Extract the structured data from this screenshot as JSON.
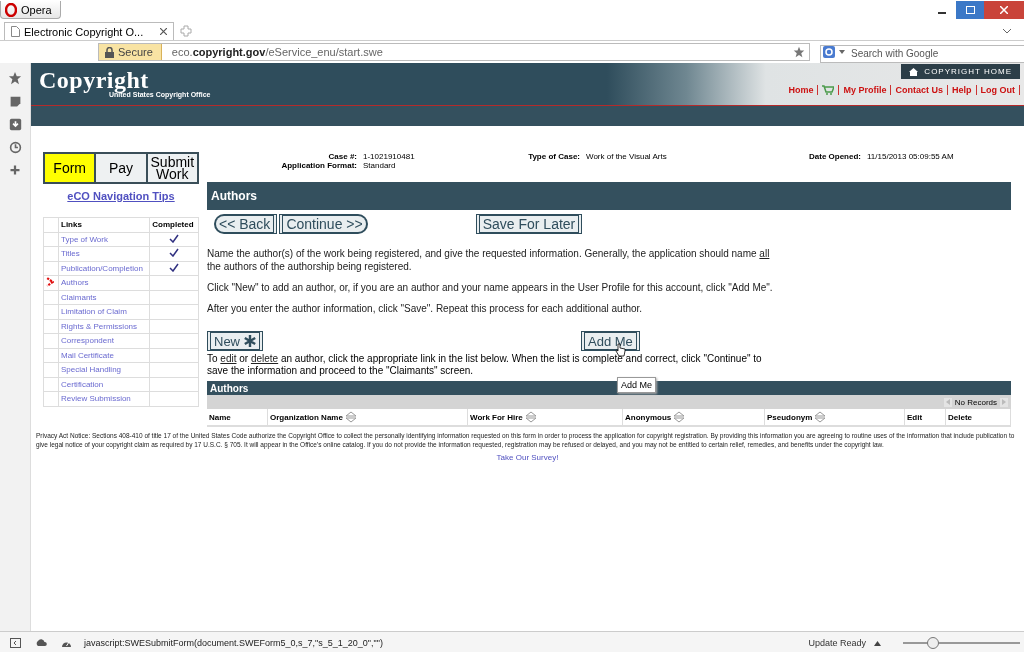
{
  "browser": {
    "menu_button": "Opera",
    "tab": {
      "title": "Electronic Copyright O..."
    },
    "address": {
      "secure_label": "Secure",
      "url": "eco.**copyright.gov**/eService_enu/start.swe"
    },
    "search": {
      "placeholder": "Search with Google"
    }
  },
  "header": {
    "logo": "Copyright",
    "subtitle": "United States Copyright Office",
    "home_button": "COPYRIGHT HOME",
    "nav": [
      {
        "kind": "link",
        "label": "Home"
      },
      {
        "kind": "cart"
      },
      {
        "kind": "link",
        "label": "My Profile"
      },
      {
        "kind": "link",
        "label": "Contact Us"
      },
      {
        "kind": "link",
        "label": "Help"
      },
      {
        "kind": "link",
        "label": "Log Out"
      }
    ]
  },
  "steps": [
    {
      "label": "Form",
      "selected": true
    },
    {
      "label": "Pay",
      "selected": false
    },
    {
      "label": "Submit Work",
      "selected": false
    }
  ],
  "nav_tips": "eCO Navigation Tips",
  "links_table": {
    "columns": [
      "Links",
      "Completed"
    ],
    "rows": [
      {
        "label": "Type of Work",
        "completed": true,
        "current": false
      },
      {
        "label": "Titles",
        "completed": true,
        "current": false
      },
      {
        "label": "Publication/Completion",
        "completed": true,
        "current": false
      },
      {
        "label": "Authors",
        "completed": false,
        "current": true
      },
      {
        "label": "Claimants",
        "completed": false,
        "current": false
      },
      {
        "label": "Limitation of Claim",
        "completed": false,
        "current": false
      },
      {
        "label": "Rights & Permissions",
        "completed": false,
        "current": false
      },
      {
        "label": "Correspondent",
        "completed": false,
        "current": false
      },
      {
        "label": "Mail Certificate",
        "completed": false,
        "current": false
      },
      {
        "label": "Special Handling",
        "completed": false,
        "current": false
      },
      {
        "label": "Certification",
        "completed": false,
        "current": false
      },
      {
        "label": "Review Submission",
        "completed": false,
        "current": false
      }
    ]
  },
  "case_info": [
    {
      "label": "Case #:",
      "value": "1-1021910481"
    },
    {
      "label": "Type of Case:",
      "value": "Work of the Visual Arts"
    },
    {
      "label": "Date Opened:",
      "value": "11/15/2013 05:09:55 AM"
    },
    {
      "label": "Application Format:",
      "value": "Standard"
    }
  ],
  "section_title": "Authors",
  "nav_buttons": [
    {
      "kind": "back",
      "label": "<< Back"
    },
    {
      "kind": "continue",
      "label": "Continue >>"
    },
    {
      "kind": "save",
      "label": "Save For Later"
    }
  ],
  "paragraphs": [
    [
      {
        "text": "Name the author(s) of the work being registered, and give the requested information. Generally, the application should name "
      },
      {
        "text": "all",
        "kind": "link"
      },
      {
        "text": " the authors of the authorship being registered."
      }
    ],
    [
      {
        "text": "Click \"New\" to add an author, or, if you are an author and your name appears in the User Profile for this account, click \"Add Me\"."
      }
    ],
    [
      {
        "text": "After you enter the author information, click \"Save\". Repeat this process for each additional author."
      }
    ]
  ],
  "new_button": "New",
  "add_me_button": "Add Me",
  "tooltip": "Add Me",
  "instructions": [
    {
      "text": "To "
    },
    {
      "text": "edit",
      "kind": "link"
    },
    {
      "text": " or "
    },
    {
      "text": "delete",
      "kind": "link"
    },
    {
      "text": " an author, click the appropriate link in the list below. When the list is complete and correct, click \"Continue\" to save the information and proceed to the \"Claimants\" screen."
    }
  ],
  "authors_table": {
    "title": "Authors",
    "pager": "No Records",
    "columns": [
      {
        "label": "Name",
        "sortable": false
      },
      {
        "label": "Organization Name",
        "sortable": true
      },
      {
        "label": "Work For Hire",
        "sortable": true
      },
      {
        "label": "Anonymous",
        "sortable": true
      },
      {
        "label": "Pseudonym",
        "sortable": true
      },
      {
        "label": "Edit",
        "sortable": false
      },
      {
        "label": "Delete",
        "sortable": false
      }
    ]
  },
  "privacy_notice": "Privacy Act Notice: Sections 408-410 of title 17 of the United States Code authorize the Copyright Office to collect the personally identifying information requested on this form in order to process the application for copyright registration. By providing this information you are agreeing to routine uses of the information that include publication to give legal notice of your copyright claim as required by 17 U.S.C. § 705. It will appear in the Office's online catalog. If you do not provide the information requested, registration may be refused or delayed, and you may not be entitled to certain relief, remedies, and benefits under the copyright law.",
  "survey_link": "Take Our Survey!",
  "status_bar": {
    "url": "javascript:SWESubmitForm(document.SWEForm5_0,s_7,\"s_5_1_20_0\",\"\")",
    "update": "Update Ready",
    "zoom": {
      "level": 0.26
    }
  }
}
